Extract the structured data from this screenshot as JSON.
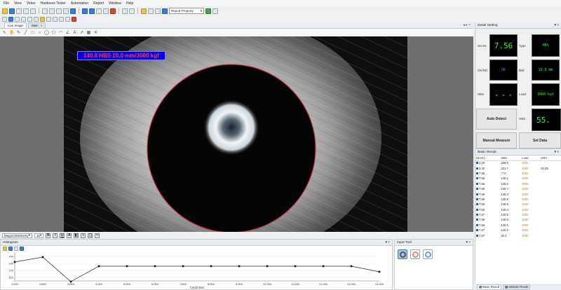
{
  "menu": [
    "File",
    "View",
    "Video",
    "Hardness Tester",
    "Automation",
    "Report",
    "Window",
    "Help"
  ],
  "toolbar": {
    "report_select": "Report Property"
  },
  "doc_tabs": [
    {
      "label": "Live Image"
    },
    {
      "label": "Main"
    }
  ],
  "image": {
    "measure_label": "140.8 HBS 10.0 mm/3000 kgf"
  },
  "format_bar": {
    "font": "MagicOfStrikeSty",
    "size": "10"
  },
  "histogram": {
    "title": "Histogram",
    "chart_data": {
      "type": "line",
      "x": [
        "1.000",
        "2.000",
        "3.000",
        "4.000",
        "5.000",
        "6.000",
        "7.000",
        "8.000",
        "9.000",
        "10.000",
        "11.000",
        "12.000",
        "13.000",
        "14.000"
      ],
      "values": [
        132.0,
        139.0,
        104.0,
        126.0,
        126.0,
        126.0,
        126.0,
        126.0,
        126.0,
        126.0,
        126.0,
        126.0,
        126.0,
        118.0
      ],
      "yticks": [
        "150",
        "140",
        "130",
        "120",
        "110"
      ],
      "ylim": [
        105,
        145
      ],
      "xlabel": "Credit start"
    }
  },
  "input_tool": {
    "title": "Input Tool"
  },
  "detail_setting": {
    "title": "Detail Setting",
    "fields": {
      "scan": {
        "label": "SCAN",
        "value": "7.56"
      },
      "type": {
        "label": "Type",
        "value": "HBS"
      },
      "ok_ng": {
        "label": "OK/NG",
        "value": "OK"
      },
      "ball": {
        "label": "Ball",
        "value": "10.0 mm"
      },
      "hbs": {
        "label": "HBS",
        "value": "- - -"
      },
      "load": {
        "label": "Load",
        "value": "3000 kgf"
      },
      "hbs2": {
        "label": "HBS",
        "value": "55."
      }
    },
    "buttons": {
      "auto_detect": "Auto Detect",
      "manual_measure": "Manual Measure",
      "set_data": "Set Data"
    }
  },
  "basic_result": {
    "title": "Basic Result",
    "columns": [
      "D(mm)",
      "HBS",
      "Load",
      "HRC"
    ],
    "rows": [
      [
        "4.00",
        "228.6",
        "3000",
        ""
      ],
      [
        "3.42",
        "321.7",
        "3000",
        "33.05"
      ],
      [
        "7.56",
        "-7.0",
        "3000",
        ""
      ],
      [
        "7.56",
        "140.2",
        "3000",
        ""
      ],
      [
        "7.56",
        "135.0",
        "3000",
        ""
      ],
      [
        "7.56",
        "140.7",
        "3000",
        ""
      ],
      [
        "7.56",
        "140.3",
        "3000",
        ""
      ],
      [
        "7.56",
        "135.8",
        "3000",
        ""
      ],
      [
        "7.56",
        "140.8",
        "3000",
        ""
      ],
      [
        "7.56",
        "140.4",
        "3000",
        ""
      ],
      [
        "7.57",
        "140.5",
        "3000",
        ""
      ],
      [
        "7.56",
        "140.8",
        "3000",
        ""
      ],
      [
        "7.56",
        "140.5",
        "3000",
        ""
      ],
      [
        "7.57",
        "140.2",
        "3000",
        ""
      ],
      [
        "7.57",
        "32.4",
        "3000",
        ""
      ]
    ]
  },
  "bottom_tabs": [
    "Basic Result",
    "Statistic Result"
  ]
}
